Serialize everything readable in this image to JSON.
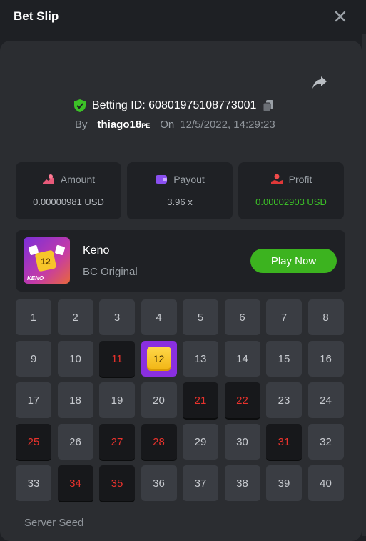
{
  "header": {
    "title": "Bet Slip"
  },
  "bet": {
    "id_label": "Betting ID: 60801975108773001",
    "by_label": "By",
    "user": "thiago18",
    "user_suffix": "PE",
    "on_label": "On",
    "date": "12/5/2022, 14:29:23"
  },
  "stats": [
    {
      "label": "Amount",
      "value": "0.00000981 USD",
      "icon": "coins-icon"
    },
    {
      "label": "Payout",
      "value": "3.96 x",
      "icon": "wallet-icon"
    },
    {
      "label": "Profit",
      "value": "0.00002903 USD",
      "icon": "hand-coin-icon"
    }
  ],
  "game": {
    "name": "Keno",
    "subtitle": "BC Original",
    "thumb_label": "KENO",
    "thumb_number": "12",
    "play_label": "Play Now"
  },
  "grid": {
    "numbers": [
      "1",
      "2",
      "3",
      "4",
      "5",
      "6",
      "7",
      "8",
      "9",
      "10",
      "11",
      "12",
      "13",
      "14",
      "15",
      "16",
      "17",
      "18",
      "19",
      "20",
      "21",
      "22",
      "23",
      "24",
      "25",
      "26",
      "27",
      "28",
      "29",
      "30",
      "31",
      "32",
      "33",
      "34",
      "35",
      "36",
      "37",
      "38",
      "39",
      "40"
    ],
    "selected_missed": [
      11,
      21,
      22,
      25,
      27,
      28,
      31,
      34,
      35
    ],
    "selected_hit": [
      12
    ]
  },
  "footer": {
    "server_seed_label": "Server Seed"
  },
  "colors": {
    "accent_green": "#3cb31f",
    "miss_red": "#e8322c",
    "hit_purple": "#8a2fe0",
    "profit_green": "#3cc227"
  }
}
